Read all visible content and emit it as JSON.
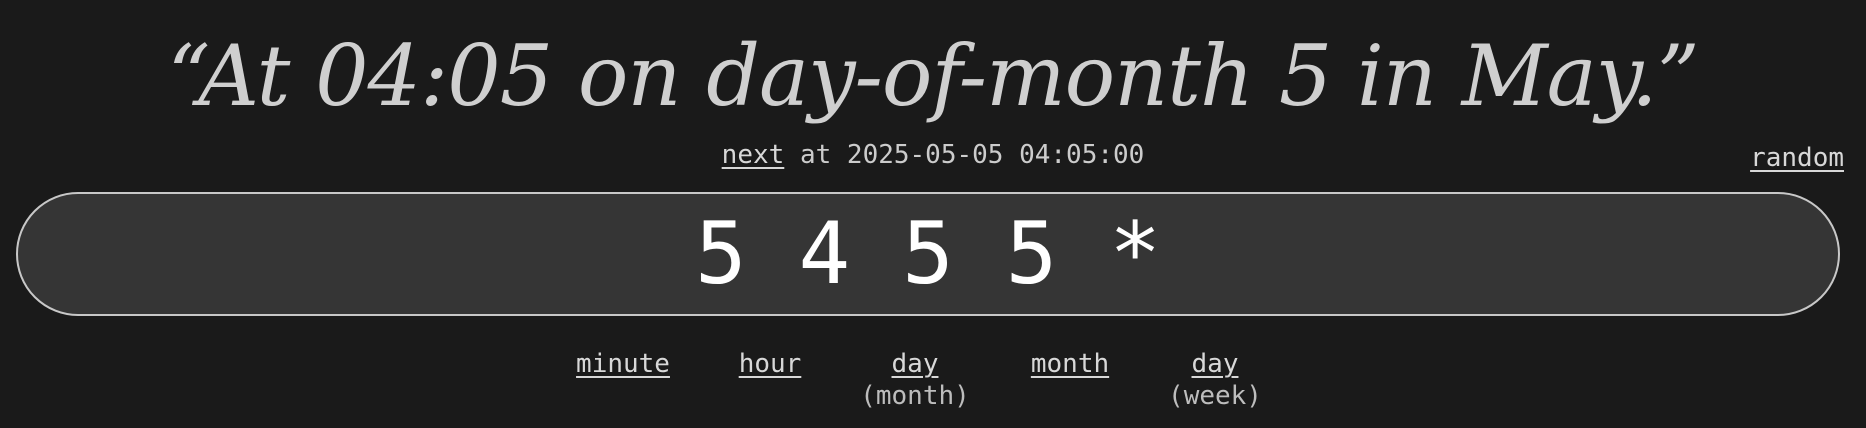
{
  "description": "“At 04:05 on day-of-month 5 in May.”",
  "next": {
    "link_label": "next",
    "text": " at 2025-05-05 04:05:00"
  },
  "random_label": "random",
  "cron_input": {
    "value": "5 4 5 5 *"
  },
  "parts": [
    {
      "label": "minute",
      "sub": ""
    },
    {
      "label": "hour",
      "sub": ""
    },
    {
      "label": "day",
      "sub": "(month)"
    },
    {
      "label": "month",
      "sub": ""
    },
    {
      "label": "day",
      "sub": "(week)"
    }
  ]
}
